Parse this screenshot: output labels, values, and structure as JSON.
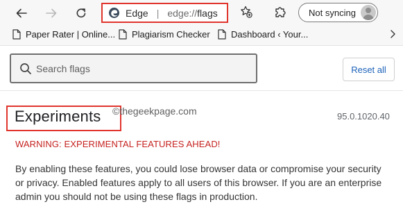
{
  "browser": {
    "omnibox": {
      "scheme_label": "Edge",
      "separator": "|",
      "url_prefix": "edge://",
      "url_path": "flags"
    },
    "profile": {
      "label": "Not syncing"
    }
  },
  "bookmarks": [
    {
      "label": "Paper Rater | Online..."
    },
    {
      "label": "Plagiarism Checker"
    },
    {
      "label": "Dashboard ‹ Your..."
    }
  ],
  "flags_page": {
    "search": {
      "placeholder": "Search flags",
      "value": ""
    },
    "reset_label": "Reset all",
    "title": "Experiments",
    "watermark": "©thegeekpage.com",
    "version": "95.0.1020.40",
    "warning": "WARNING: EXPERIMENTAL FEATURES AHEAD!",
    "description": "By enabling these features, you could lose browser data or compromise your security or privacy. Enabled features apply to all users of this browser. If you are an enterprise admin you should not be using these flags in production."
  },
  "colors": {
    "highlight": "#e0342c",
    "warning": "#c5221f",
    "link": "#1a61b8"
  }
}
